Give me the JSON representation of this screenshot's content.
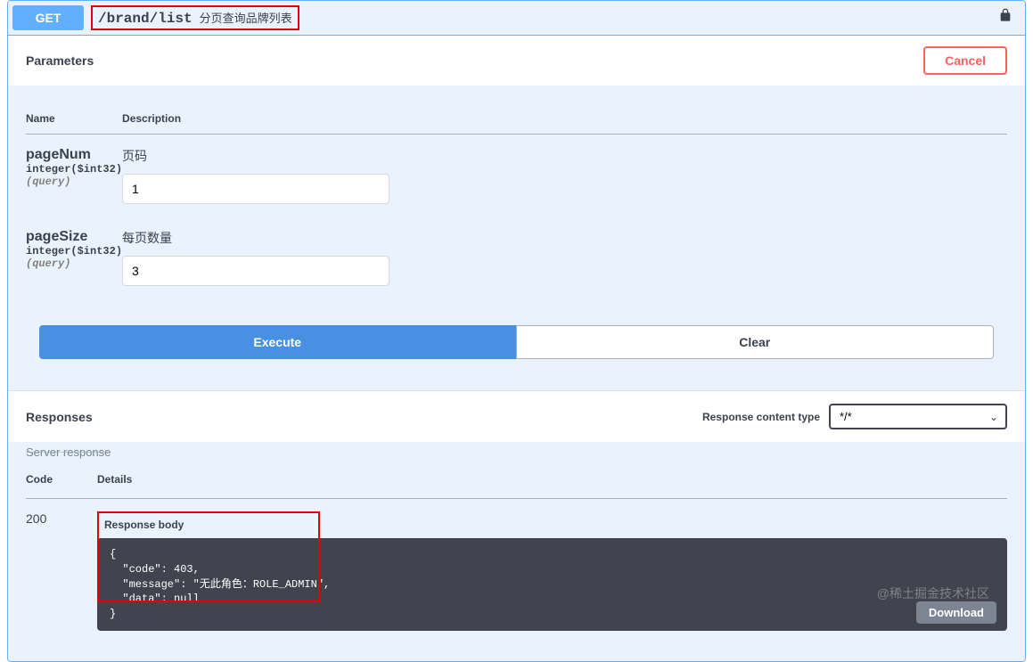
{
  "summary": {
    "method": "GET",
    "path": "/brand/list",
    "description": "分页查询品牌列表"
  },
  "parameters": {
    "section_title": "Parameters",
    "cancel_label": "Cancel",
    "headers": {
      "name": "Name",
      "description": "Description"
    },
    "items": [
      {
        "name": "pageNum",
        "type": "integer($int32)",
        "in": "(query)",
        "desc": "页码",
        "value": "1"
      },
      {
        "name": "pageSize",
        "type": "integer($int32)",
        "in": "(query)",
        "desc": "每页数量",
        "value": "3"
      }
    ]
  },
  "actions": {
    "execute": "Execute",
    "clear": "Clear"
  },
  "responses": {
    "section_title": "Responses",
    "content_type_label": "Response content type",
    "content_type_value": "*/*",
    "server_response_label": "Server response",
    "headers": {
      "code": "Code",
      "details": "Details"
    },
    "row": {
      "code": "200",
      "body_label": "Response body",
      "body_text": "{\n  \"code\": 403,\n  \"message\": \"无此角色：ROLE_ADMIN\",\n  \"data\": null\n}",
      "download": "Download"
    }
  },
  "watermark": "@稀土掘金技术社区"
}
